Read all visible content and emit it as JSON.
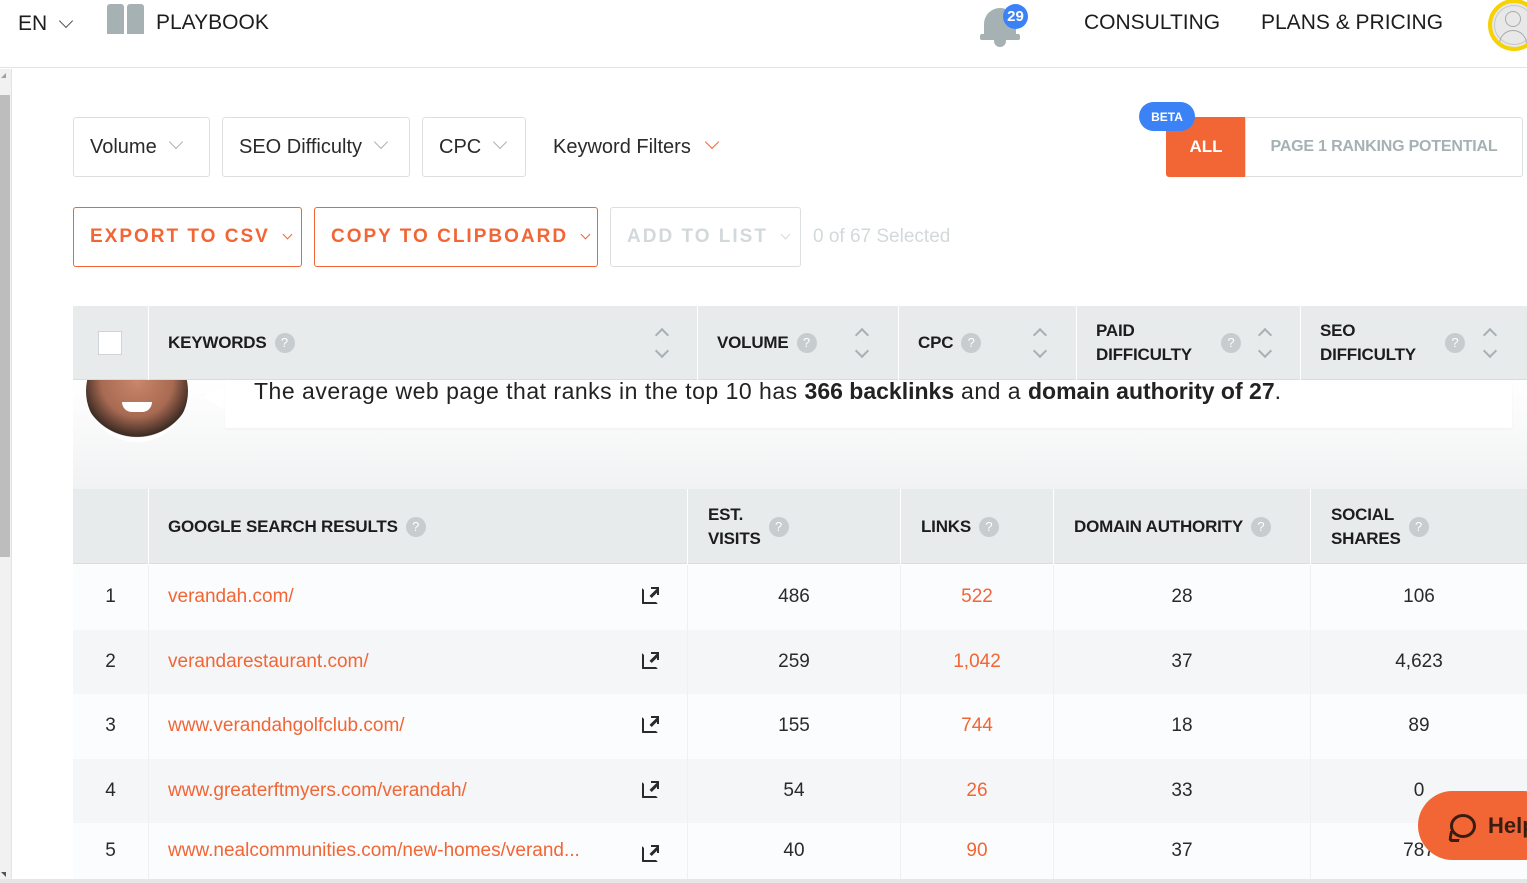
{
  "topnav": {
    "language": "EN",
    "playbook_label": "PLAYBOOK",
    "notifications_count": "29",
    "links": [
      "CONSULTING",
      "PLANS & PRICING"
    ]
  },
  "filters": {
    "volume": "Volume",
    "seo_difficulty": "SEO Difficulty",
    "cpc": "CPC",
    "keyword_filters": "Keyword Filters"
  },
  "view_toggle": {
    "badge": "BETA",
    "all": "ALL",
    "page1": "PAGE 1 RANKING POTENTIAL",
    "active": "ALL"
  },
  "actions": {
    "export": "EXPORT TO CSV",
    "copy": "COPY TO CLIPBOARD",
    "add_to_list": "ADD TO LIST",
    "selected_text": "0 of 67 Selected"
  },
  "keyword_table": {
    "columns": [
      "KEYWORDS",
      "VOLUME",
      "CPC",
      "PAID DIFFICULTY",
      "SEO DIFFICULTY"
    ]
  },
  "info_panel": {
    "text_1": "The average web page that ranks in the top 10 has ",
    "bold_1": "366 backlinks",
    "text_2": " and a ",
    "bold_2": "domain authority of 27",
    "text_3": "."
  },
  "results_table": {
    "columns": {
      "results": "GOOGLE SEARCH RESULTS",
      "visits_1": "EST.",
      "visits_2": "VISITS",
      "links": "LINKS",
      "domain_authority": "DOMAIN AUTHORITY",
      "social_1": "SOCIAL",
      "social_2": "SHARES"
    },
    "rows": [
      {
        "rank": "1",
        "url": "verandah.com/",
        "visits": "486",
        "links": "522",
        "da": "28",
        "social": "106"
      },
      {
        "rank": "2",
        "url": "verandarestaurant.com/",
        "visits": "259",
        "links": "1,042",
        "da": "37",
        "social": "4,623"
      },
      {
        "rank": "3",
        "url": "www.verandahgolfclub.com/",
        "visits": "155",
        "links": "744",
        "da": "18",
        "social": "89"
      },
      {
        "rank": "4",
        "url": "www.greaterftmyers.com/verandah/",
        "visits": "54",
        "links": "26",
        "da": "33",
        "social": "0"
      },
      {
        "rank": "5",
        "url": "www.nealcommunities.com/new-homes/verand...",
        "visits": "40",
        "links": "90",
        "da": "37",
        "social": "787"
      }
    ]
  },
  "help": {
    "label": "Help"
  },
  "colors": {
    "accent": "#f26535",
    "beta": "#3b82f6",
    "header_bg": "#e8ebec"
  }
}
